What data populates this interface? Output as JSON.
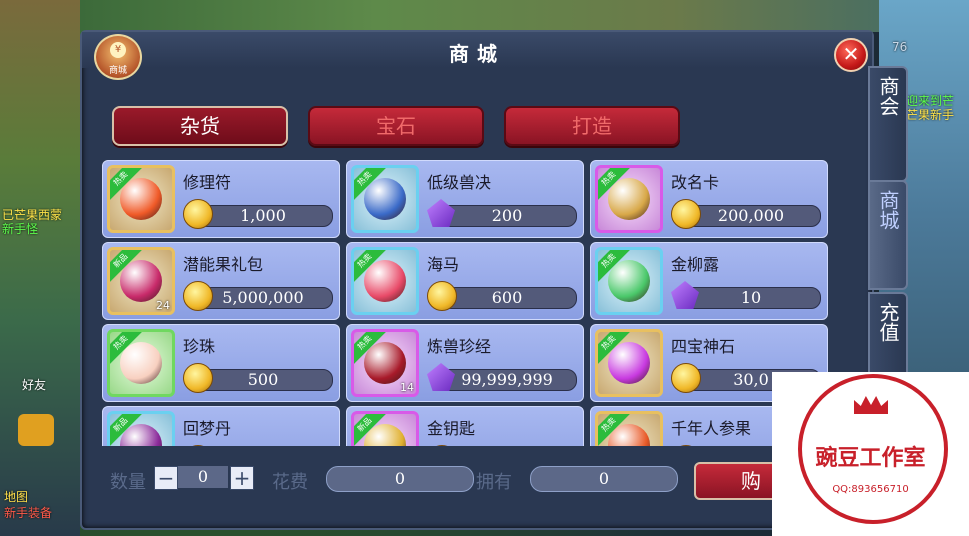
{
  "window": {
    "title": "商城",
    "badge_label": "商城",
    "badge_coin": "¥",
    "close": "✕"
  },
  "categories": [
    {
      "label": "杂货",
      "active": true
    },
    {
      "label": "宝石",
      "active": false
    },
    {
      "label": "打造",
      "active": false
    }
  ],
  "items": [
    {
      "name": "修理符",
      "price": "1,000",
      "currency": "gold",
      "tag": "热卖",
      "frame": "gold",
      "icon_color": "#f05a28",
      "qty": ""
    },
    {
      "name": "低级兽决",
      "price": "200",
      "currency": "gem",
      "tag": "热卖",
      "frame": "blue",
      "icon_color": "#3a6ac8",
      "qty": ""
    },
    {
      "name": "改名卡",
      "price": "200,000",
      "currency": "gold",
      "tag": "热卖",
      "frame": "purple",
      "icon_color": "#d8a848",
      "qty": ""
    },
    {
      "name": "潜能果礼包",
      "price": "5,000,000",
      "currency": "gold",
      "tag": "新品",
      "frame": "gold",
      "icon_color": "#c82a6a",
      "qty": "24"
    },
    {
      "name": "海马",
      "price": "600",
      "currency": "gold",
      "tag": "热卖",
      "frame": "blue",
      "icon_color": "#e84a68",
      "qty": ""
    },
    {
      "name": "金柳露",
      "price": "10",
      "currency": "gem",
      "tag": "热卖",
      "frame": "blue",
      "icon_color": "#4ac86a",
      "qty": ""
    },
    {
      "name": "珍珠",
      "price": "500",
      "currency": "gold",
      "tag": "热卖",
      "frame": "green",
      "icon_color": "#f8d0c0",
      "qty": ""
    },
    {
      "name": "炼兽珍经",
      "price": "99,999,999",
      "currency": "gem",
      "tag": "热卖",
      "frame": "purple",
      "icon_color": "#a81a2a",
      "qty": "14"
    },
    {
      "name": "四宝神石",
      "price": "30,0",
      "currency": "gold",
      "tag": "热卖",
      "frame": "gold",
      "icon_color": "#c83ae0",
      "qty": ""
    },
    {
      "name": "回梦丹",
      "price": "",
      "currency": "gold",
      "tag": "新品",
      "frame": "blue",
      "icon_color": "#8a2a9a",
      "qty": ""
    },
    {
      "name": "金钥匙",
      "price": "",
      "currency": "gold",
      "tag": "新品",
      "frame": "purple",
      "icon_color": "#e0b030",
      "qty": ""
    },
    {
      "name": "千年人参果",
      "price": "",
      "currency": "gold",
      "tag": "热卖",
      "frame": "gold",
      "icon_color": "#e85a28",
      "qty": ""
    }
  ],
  "bottom": {
    "quantity_label": "数量",
    "quantity_value": "0",
    "minus": "−",
    "plus": "+",
    "cost_label": "花费",
    "cost_value": "0",
    "owned_label": "拥有",
    "owned_value": "0",
    "buy_label": "购"
  },
  "side_tabs": [
    {
      "label": "商会",
      "active": false
    },
    {
      "label": "商城",
      "active": true
    },
    {
      "label": "充值",
      "active": false
    }
  ],
  "background_text": {
    "top_number": "76",
    "left_lines": [
      "已芒果西蒙",
      "新手怪"
    ],
    "right_lines": [
      "迎来到芒",
      "芒果新手"
    ],
    "friend": "好友",
    "map": "地图",
    "bottom_left": "新手装备"
  },
  "watermark": {
    "text": "豌豆工作室",
    "qq": "QQ:893656710"
  }
}
